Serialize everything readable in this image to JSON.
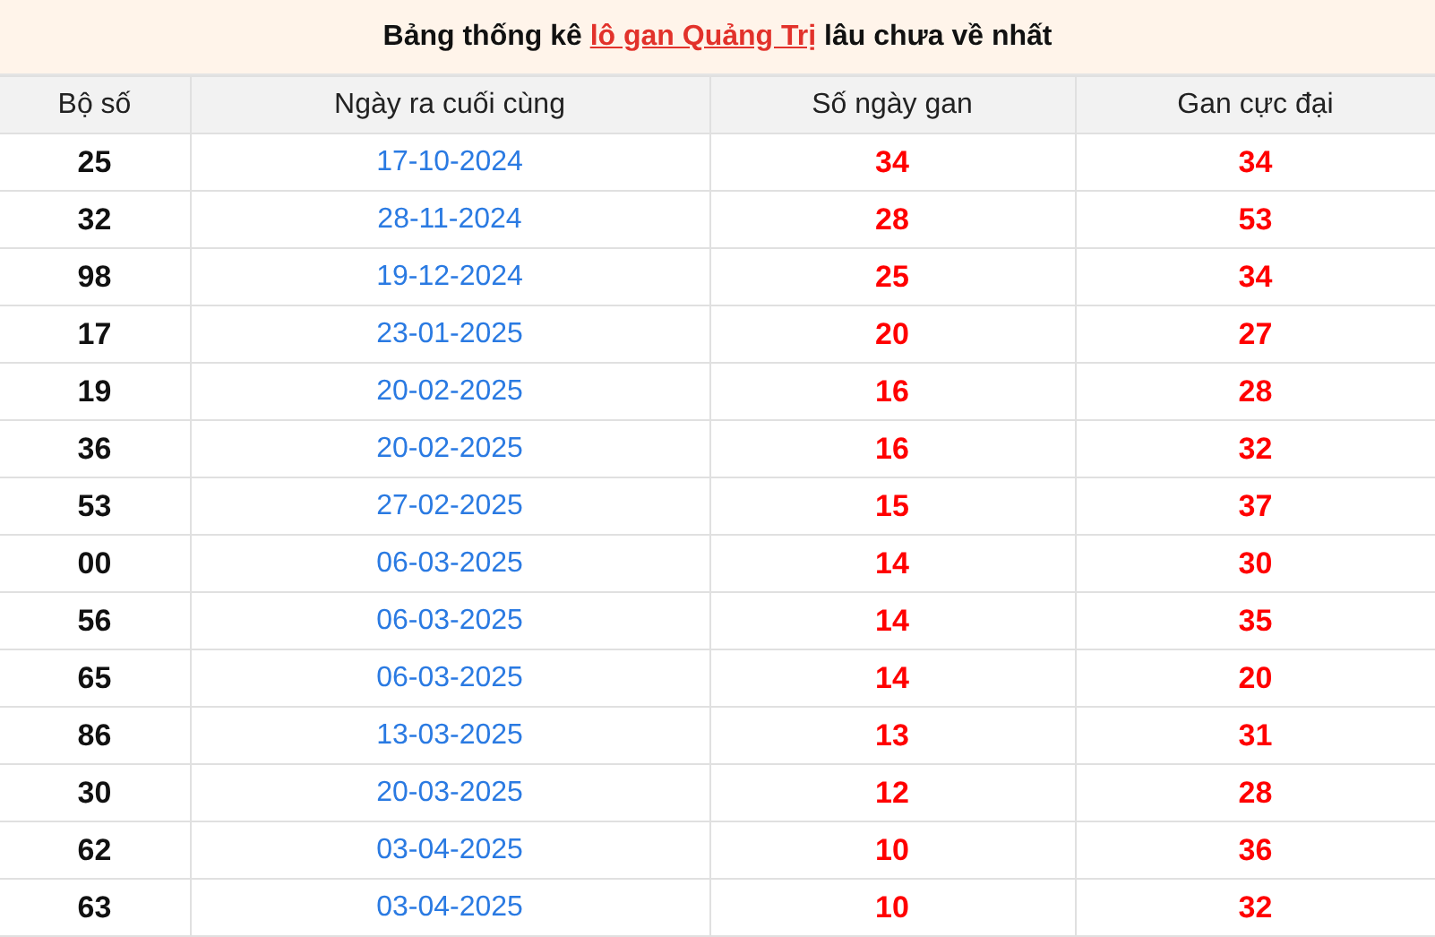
{
  "title": {
    "before": "Bảng thống kê",
    "link": "lô gan Quảng Trị",
    "after": "lâu chưa về nhất"
  },
  "table": {
    "columns": [
      "Bộ số",
      "Ngày ra cuối cùng",
      "Số ngày gan",
      "Gan cực đại"
    ],
    "rows": [
      [
        "25",
        "17-10-2024",
        "34",
        "34"
      ],
      [
        "32",
        "28-11-2024",
        "28",
        "53"
      ],
      [
        "98",
        "19-12-2024",
        "25",
        "34"
      ],
      [
        "17",
        "23-01-2025",
        "20",
        "27"
      ],
      [
        "19",
        "20-02-2025",
        "16",
        "28"
      ],
      [
        "36",
        "20-02-2025",
        "16",
        "32"
      ],
      [
        "53",
        "27-02-2025",
        "15",
        "37"
      ],
      [
        "00",
        "06-03-2025",
        "14",
        "30"
      ],
      [
        "56",
        "06-03-2025",
        "14",
        "35"
      ],
      [
        "65",
        "06-03-2025",
        "14",
        "20"
      ],
      [
        "86",
        "13-03-2025",
        "13",
        "31"
      ],
      [
        "30",
        "20-03-2025",
        "12",
        "28"
      ],
      [
        "62",
        "03-04-2025",
        "10",
        "36"
      ],
      [
        "63",
        "03-04-2025",
        "10",
        "32"
      ]
    ]
  }
}
